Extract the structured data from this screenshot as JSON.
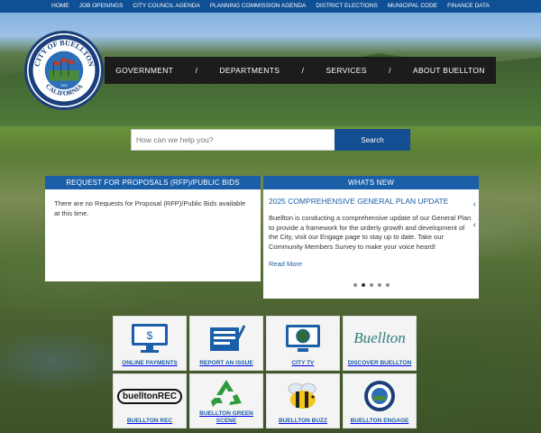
{
  "topnav": [
    "HOME",
    "JOB OPENINGS",
    "CITY COUNCIL AGENDA",
    "PLANNING COMMISSION AGENDA",
    "DISTRICT ELECTIONS",
    "MUNICIPAL CODE",
    "FINANCE DATA"
  ],
  "seal": {
    "top_text": "CITY OF BUELLTON",
    "bottom_text": "CALIFORNIA",
    "year": "1992"
  },
  "mainnav": [
    "GOVERNMENT",
    "DEPARTMENTS",
    "SERVICES",
    "ABOUT BUELLTON"
  ],
  "nav_separator": "/",
  "search": {
    "placeholder": "How can we help you?",
    "button": "Search"
  },
  "rfp": {
    "title": "REQUEST FOR PROPOSALS (RFP)/PUBLIC BIDS",
    "text": "There are no Requests for Proposal (RFP)/Public Bids available at this time."
  },
  "news": {
    "title": "WHATS NEW",
    "item_title": "2025 COMPREHENSIVE GENERAL PLAN UPDATE",
    "item_text": "Buellton is conducting a comprehensive update of our General Plan to provide a framework for the orderly growth and development of the City, visit our Engage page to stay up to date. Take our Community Members Survey to make your voice heard!",
    "more": "Read More",
    "arrow": "‹",
    "slide_count": 5,
    "active_slide": 2
  },
  "tiles": [
    {
      "label": "ONLINE PAYMENTS",
      "icon": "computer-payment-icon"
    },
    {
      "label": "REPORT AN ISSUE",
      "icon": "report-form-icon"
    },
    {
      "label": "CITY TV",
      "icon": "tv-icon"
    },
    {
      "label": "DISCOVER BUELLTON",
      "icon": "discover-logo-icon",
      "logo_text": "Buellton"
    },
    {
      "label": "BUELLTON REC",
      "icon": "rec-logo-icon",
      "logo_text": "buelltonREC"
    },
    {
      "label": "BUELLTON GREEN SCENE",
      "icon": "recycle-icon"
    },
    {
      "label": "BUELLTON BUZZ",
      "icon": "bee-icon"
    },
    {
      "label": "BUELLTON ENGAGE",
      "icon": "engage-seal-icon"
    }
  ],
  "colors": {
    "topbar": "#0f4f95",
    "accent": "#1b5fa8",
    "nav_bg": "#1c1c1c"
  }
}
